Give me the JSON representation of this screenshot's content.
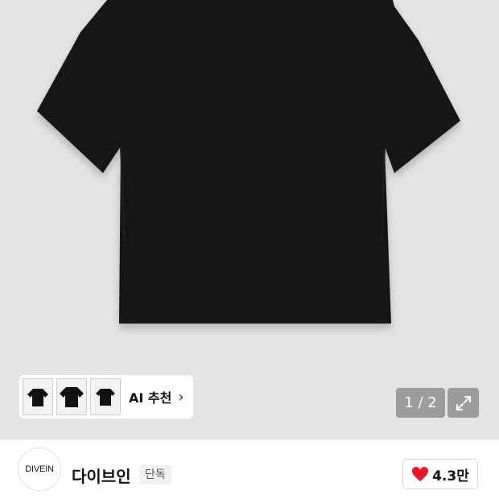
{
  "gallery": {
    "ai_recommend_label": "AI 추천",
    "thumbnails": [
      "black-tshirt-thumb",
      "black-tshirt-thumb",
      "black-tshirt-thumb"
    ],
    "pager_text": "1 / 2",
    "expand_icon": "expand-arrows-icon",
    "chevron_icon": "chevron-right-icon"
  },
  "brand": {
    "logo_text": "DIVEIN",
    "name": "다이브인",
    "tag": "단독"
  },
  "like": {
    "icon": "heart-icon",
    "count": "4.3만",
    "heart_color": "#e8192c"
  }
}
